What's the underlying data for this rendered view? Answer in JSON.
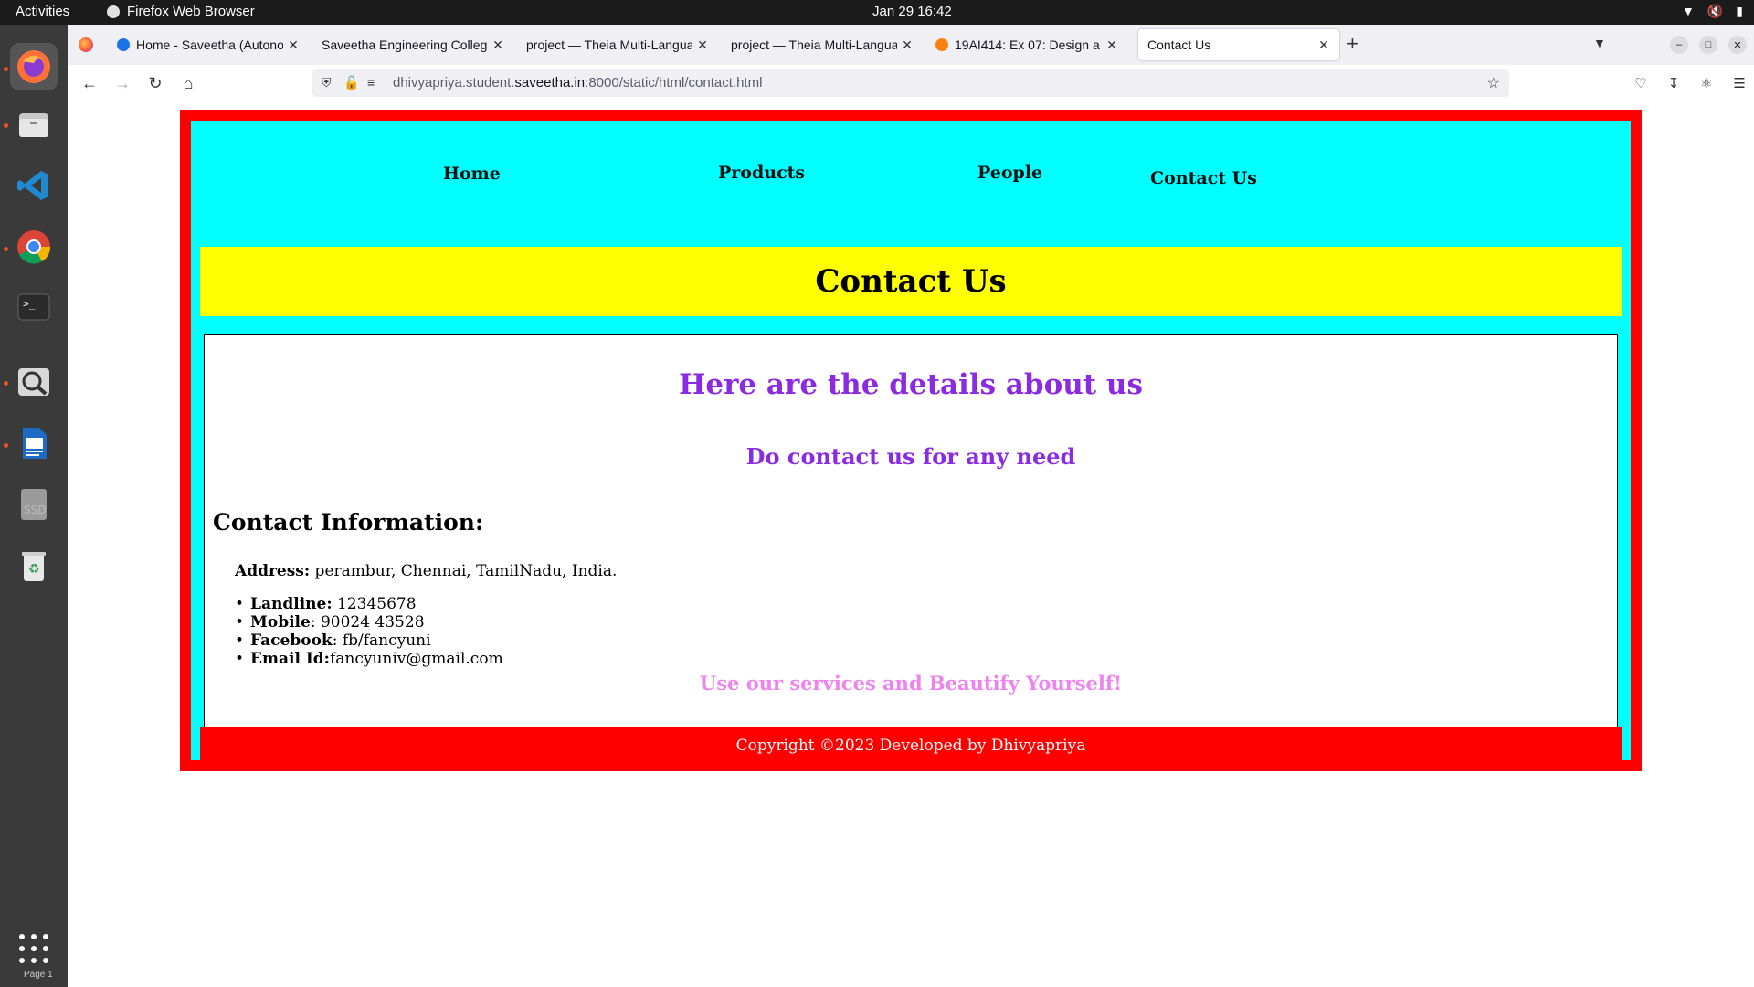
{
  "topbar": {
    "activities": "Activities",
    "app_name": "Firefox Web Browser",
    "clock": "Jan 29  16:42",
    "tray_icons": [
      "wifi-icon",
      "volume-muted-icon",
      "battery-icon"
    ]
  },
  "dock": {
    "items": [
      "firefox-icon",
      "files-icon",
      "vscode-icon",
      "chrome-icon",
      "terminal-icon",
      "image-viewer-icon",
      "writer-icon",
      "ssd-icon",
      "trash-icon"
    ],
    "bottom_label": "Page 1"
  },
  "tabs": [
    {
      "title": "Home - Saveetha (Autonom",
      "icon_color": "#1a73e8"
    },
    {
      "title": "Saveetha Engineering College",
      "icon_color": ""
    },
    {
      "title": "project — Theia Multi-Language",
      "icon_color": ""
    },
    {
      "title": "project — Theia Multi-Language",
      "icon_color": ""
    },
    {
      "title": "19AI414: Ex 07: Design a",
      "icon_color": "#f98012"
    },
    {
      "title": "Contact Us",
      "icon_color": ""
    }
  ],
  "url": {
    "prefix": "dhivyapriya.student.",
    "host": "saveetha.in",
    "suffix": ":8000/static/html/contact.html"
  },
  "site": {
    "nav": [
      "Home",
      "Products",
      "People",
      "Contact Us"
    ],
    "banner_title": "Contact Us",
    "heading": "Here are the details about us",
    "subheading": "Do contact us for any need",
    "contact_title": "Contact Information:",
    "address_label": "Address:",
    "address_value": " perambur, Chennai, TamilNadu, India.",
    "contacts": [
      {
        "label": "Landline:",
        "value": " 12345678"
      },
      {
        "label": "Mobile",
        "value": ": 90024 43528"
      },
      {
        "label": "Facebook",
        "value": ": fb/fancyuni"
      },
      {
        "label": "Email Id:",
        "value": "fancyuniv@gmail.com"
      }
    ],
    "slogan": "Use our services and Beautify Yourself!",
    "footer": "Copyright ©2023 Developed by Dhivyapriya"
  },
  "colors": {
    "outer_border": "#ff0000",
    "background": "#00ffff",
    "banner": "#ffff00",
    "heading": "#8a2be2",
    "slogan": "#ee82ee",
    "footer": "#ff0000"
  }
}
